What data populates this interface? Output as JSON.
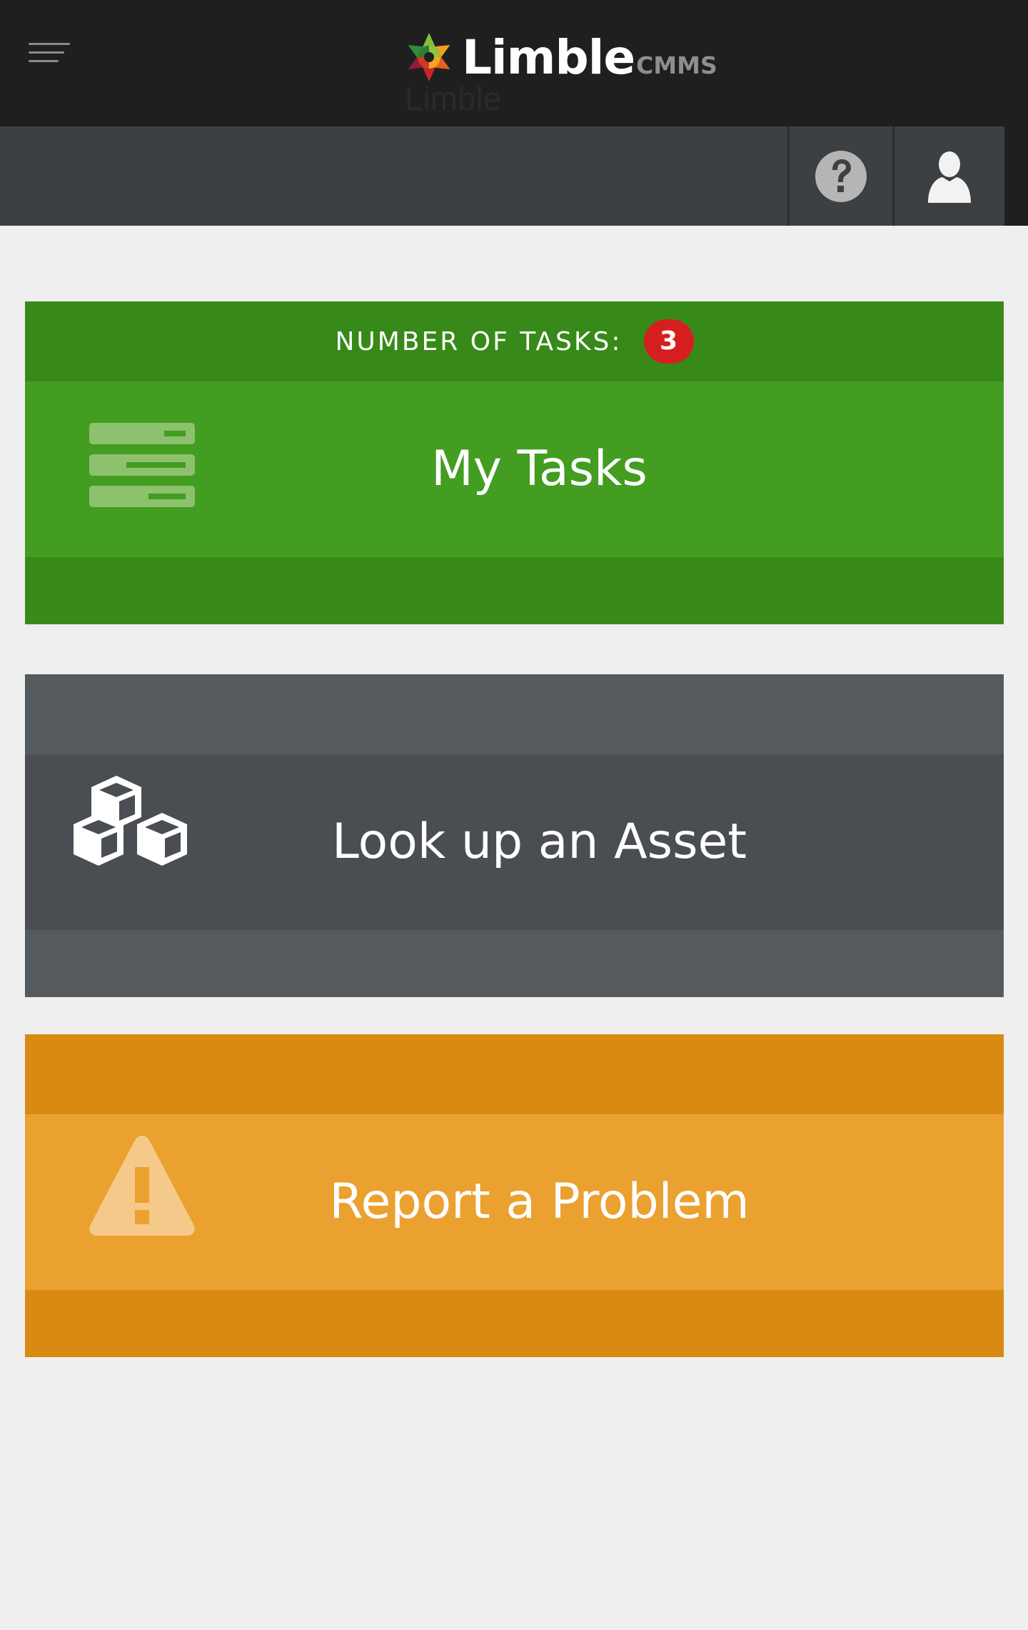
{
  "header": {
    "logo": {
      "wordmark": "Limble",
      "suffix": "CMMS"
    },
    "ghost_title": "Limble",
    "menu_icon": "hamburger-menu-icon",
    "help_icon": "question-circle-icon",
    "user_icon": "user-silhouette-icon"
  },
  "cards": {
    "tasks": {
      "count_label": "NUMBER OF TASKS:",
      "count": "3",
      "label": "My Tasks",
      "icon": "task-list-icon"
    },
    "asset": {
      "label": "Look up an Asset",
      "icon": "cubes-icon"
    },
    "report": {
      "label": "Report a Problem",
      "icon": "warning-triangle-icon"
    }
  },
  "colors": {
    "header_bg": "#1f1f20",
    "subbar_bg": "#3d4043",
    "page_bg": "#efefef",
    "tasks_green": "#429d20",
    "tasks_green_dark": "#378a19",
    "asset_gray": "#4a4e52",
    "asset_gray_light": "#555a5e",
    "report_orange": "#eba12f",
    "report_orange_dark": "#d98a12",
    "badge_red": "#d51f1f"
  }
}
